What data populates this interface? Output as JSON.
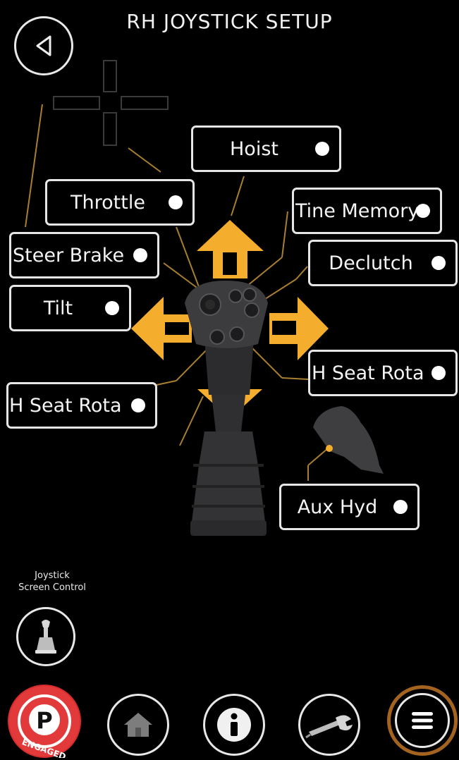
{
  "header": {
    "title": "RH JOYSTICK SETUP"
  },
  "labels": {
    "hoist": "Hoist",
    "throttle": "Throttle",
    "tine_memory": "Tine Memory",
    "steer_brake": "Steer Brake",
    "declutch": "Declutch",
    "tilt": "Tilt",
    "h_seat_rota_right": "H Seat Rota",
    "h_seat_rota_left": "H Seat Rota",
    "aux_hyd": "Aux Hyd"
  },
  "joystick_screen_control": {
    "line1": "Joystick",
    "line2": "Screen Control"
  },
  "footer": {
    "parking_badge": "ENGAGED",
    "parking_letter": "P"
  },
  "colors": {
    "accent_arrow": "#f5ad2e",
    "leader_line": "#b88a2f",
    "menu_ring": "#a4631f"
  },
  "icons": [
    "back-icon",
    "joystick-icon",
    "parking-brake-icon",
    "home-icon",
    "info-icon",
    "wrench-icon",
    "menu-icon"
  ]
}
